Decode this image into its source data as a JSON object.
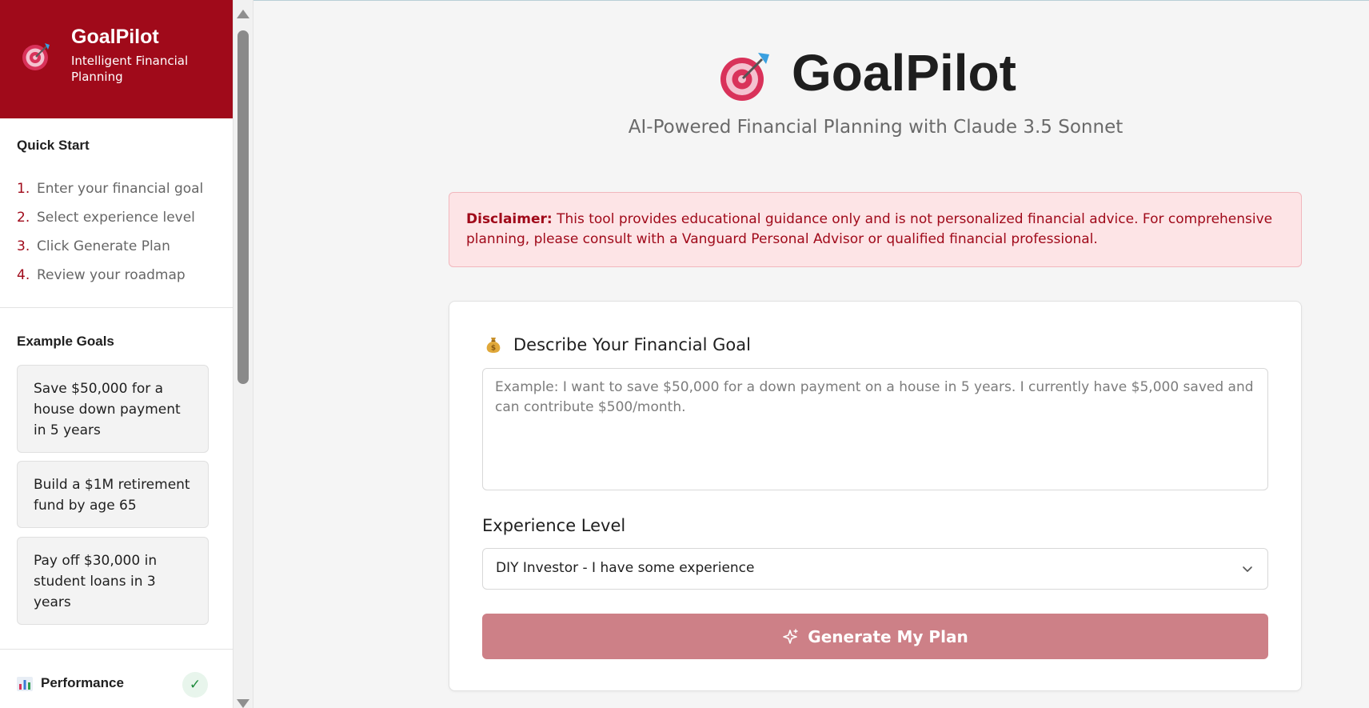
{
  "sidebar": {
    "brand": {
      "name": "GoalPilot",
      "tagline": "Intelligent Financial Planning",
      "logo_icon": "target-dart-icon"
    },
    "quick_start": {
      "title": "Quick Start",
      "steps": [
        {
          "num": "1.",
          "label": "Enter your financial goal"
        },
        {
          "num": "2.",
          "label": "Select experience level"
        },
        {
          "num": "3.",
          "label": "Click Generate Plan"
        },
        {
          "num": "4.",
          "label": "Review your roadmap"
        }
      ]
    },
    "example_goals": {
      "title": "Example Goals",
      "items": [
        "Save $50,000 for a house down payment in 5 years",
        "Build a $1M retirement fund by age 65",
        "Pay off $30,000 in student loans in 3 years"
      ]
    },
    "performance": {
      "label": "Performance",
      "icon": "bar-chart-icon",
      "status_icon": "checkmark-icon",
      "status_glyph": "✓"
    }
  },
  "header": {
    "title": "GoalPilot",
    "subtitle": "AI-Powered Financial Planning with Claude 3.5 Sonnet",
    "logo_icon": "target-dart-icon"
  },
  "disclaimer": {
    "label": "Disclaimer:",
    "text": " This tool provides educational guidance only and is not personalized financial advice. For comprehensive planning, please consult with a Vanguard Personal Advisor or qualified financial professional."
  },
  "form": {
    "goal_label": "Describe Your Financial Goal",
    "goal_icon": "money-bag-icon",
    "goal_value": "",
    "goal_placeholder": "Example: I want to save $50,000 for a down payment on a house in 5 years. I currently have $5,000 saved and can contribute $500/month.",
    "experience_label": "Experience Level",
    "experience_selected": "DIY Investor - I have some experience",
    "generate_label": "Generate My Plan",
    "generate_icon": "sparkle-icon"
  },
  "colors": {
    "brand": "#a00a1a",
    "disclaimer_bg": "#fde4e6",
    "button_disabled": "#cd8087",
    "success": "#1c8a3a"
  }
}
